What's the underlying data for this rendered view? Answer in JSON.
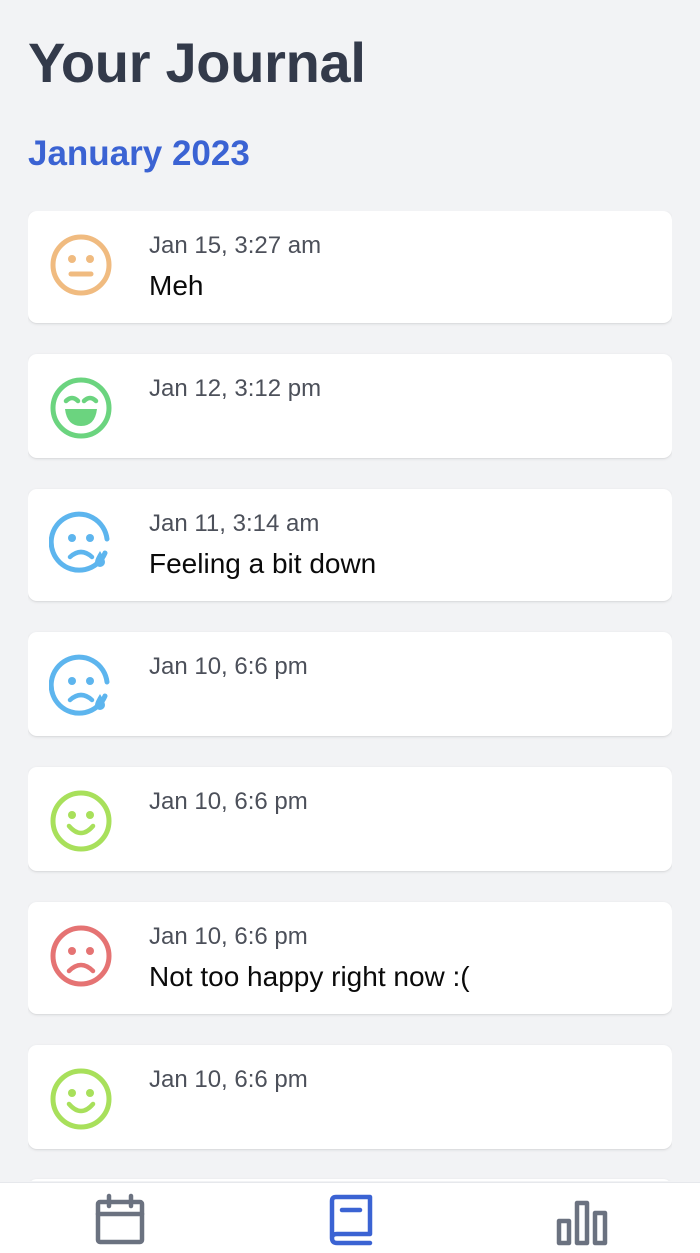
{
  "header": {
    "title": "Your Journal"
  },
  "month": {
    "label": "January 2023"
  },
  "entries": [
    {
      "date": "Jan 15, 3:27 am",
      "text": "Meh",
      "mood": "neutral-face-icon",
      "color": "#f0bb80"
    },
    {
      "date": "Jan 12, 3:12 pm",
      "text": "",
      "mood": "laughing-face-icon",
      "color": "#6bd47f"
    },
    {
      "date": "Jan 11, 3:14 am",
      "text": "Feeling a bit down",
      "mood": "sad-tear-face-icon",
      "color": "#5db5ee"
    },
    {
      "date": "Jan 10, 6:6 pm",
      "text": "",
      "mood": "sad-tear-face-icon",
      "color": "#5db5ee"
    },
    {
      "date": "Jan 10, 6:6 pm",
      "text": "",
      "mood": "smile-face-icon",
      "color": "#a8e05b"
    },
    {
      "date": "Jan 10, 6:6 pm",
      "text": "Not too happy right now :(",
      "mood": "frown-face-icon",
      "color": "#e57373"
    },
    {
      "date": "Jan 10, 6:6 pm",
      "text": "",
      "mood": "smile-face-icon",
      "color": "#a8e05b"
    }
  ],
  "nav": {
    "items": [
      {
        "icon": "calendar-icon",
        "active": false,
        "color": "#6b7280"
      },
      {
        "icon": "journal-book-icon",
        "active": true,
        "color": "#3b63d3"
      },
      {
        "icon": "bar-chart-icon",
        "active": false,
        "color": "#6b7280"
      }
    ]
  }
}
